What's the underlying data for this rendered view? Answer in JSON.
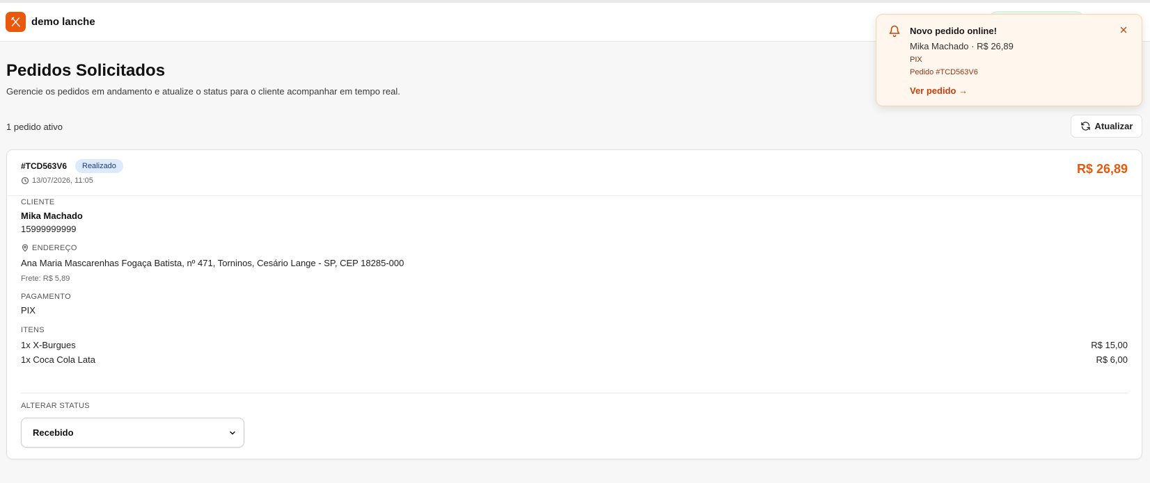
{
  "header": {
    "brand_name": "demo lanche"
  },
  "page": {
    "title": "Pedidos Solicitados",
    "subtitle": "Gerencie os pedidos em andamento e atualize o status para o cliente acompanhar em tempo real.",
    "active_count": "1 pedido ativo",
    "refresh_label": "Atualizar"
  },
  "order": {
    "id": "#TCD563V6",
    "status_badge": "Realizado",
    "datetime": "13/07/2026, 11:05",
    "total": "R$ 26,89",
    "client_label": "CLIENTE",
    "client_name": "Mika Machado",
    "client_phone": "15999999999",
    "address_label": "ENDEREÇO",
    "address": "Ana Maria Mascarenhas Fogaça Batista, nº 471, Torninos, Cesário Lange - SP, CEP 18285-000",
    "shipping": "Frete: R$ 5,89",
    "payment_label": "PAGAMENTO",
    "payment": "PIX",
    "items_label": "ITENS",
    "items": [
      {
        "name": "1x X-Burgues",
        "price": "R$ 15,00"
      },
      {
        "name": "1x Coca Cola Lata",
        "price": "R$ 6,00"
      }
    ],
    "change_status_label": "ALTERAR STATUS",
    "status_selected": "Recebido"
  },
  "toast": {
    "title": "Novo pedido online!",
    "summary": "Mika Machado · R$ 26,89",
    "payment": "PIX",
    "order_ref": "Pedido #TCD563V6",
    "link": "Ver pedido →"
  },
  "colors": {
    "brand": "#ea580c",
    "badge_bg": "#dbeafe",
    "toast_bg": "#fff7ed"
  },
  "icons": [
    "utensils-icon",
    "refresh-icon",
    "clock-icon",
    "map-pin-icon",
    "chevron-down-icon",
    "bell-icon",
    "close-icon"
  ]
}
